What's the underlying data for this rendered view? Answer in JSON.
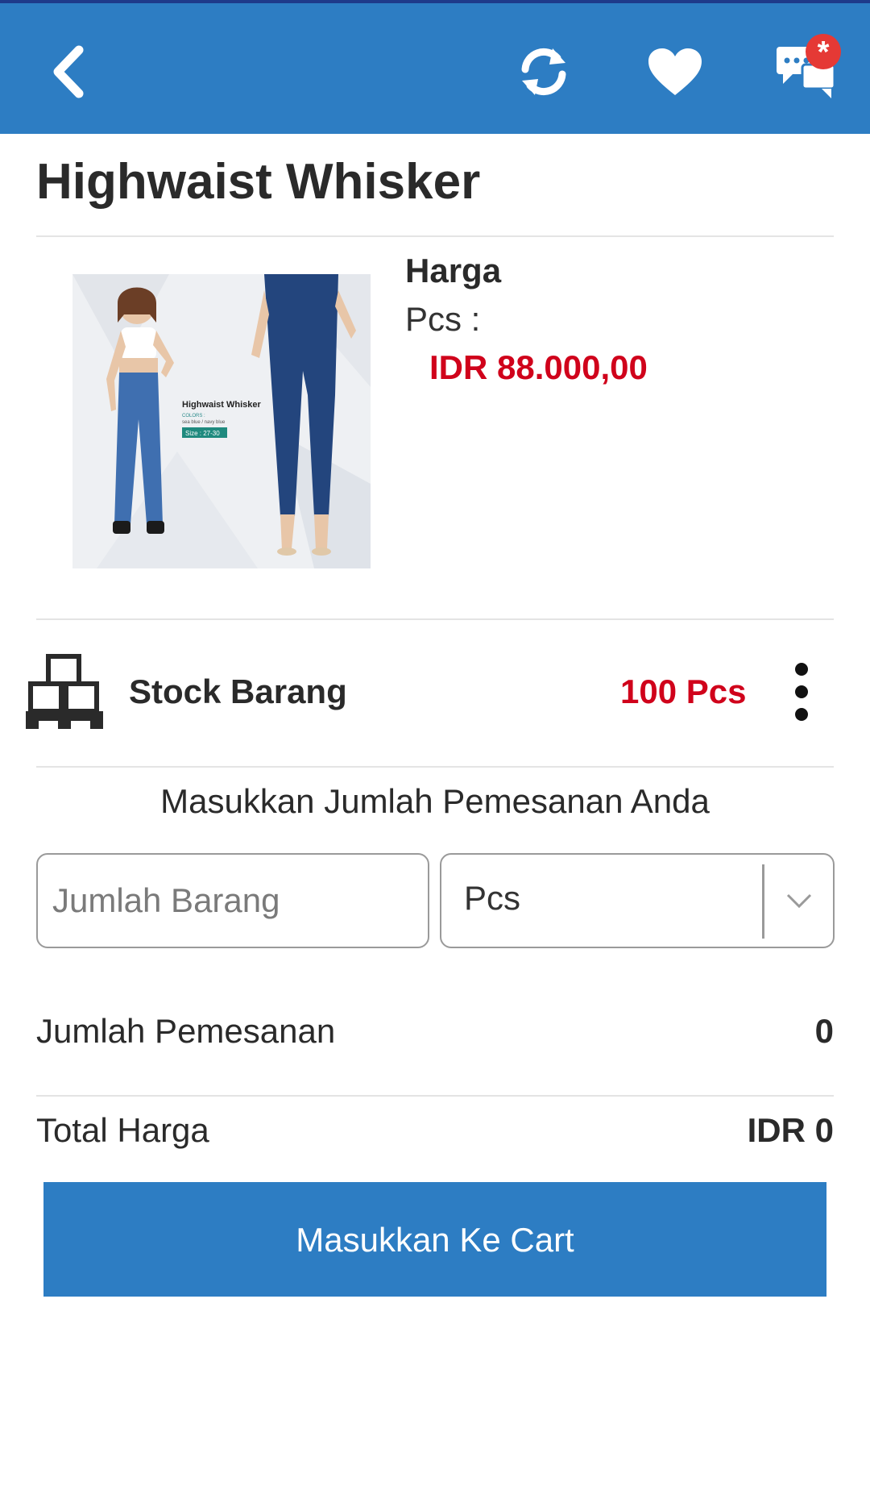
{
  "colors": {
    "primary": "#2d7dc3",
    "price_red": "#d0021b"
  },
  "appbar": {
    "back_icon": "chevron-left-icon",
    "refresh_icon": "refresh-icon",
    "favorite_icon": "heart-icon",
    "chat_icon": "chat-icon",
    "chat_badge": "*"
  },
  "product": {
    "title": "Highwaist Whisker",
    "image_caption_title": "Highwaist Whisker",
    "image_caption_colors": "COLORS :",
    "image_caption_color_list": "sea blue / navy blue",
    "image_caption_size": "Size : 27-30",
    "harga_label": "Harga",
    "unit_label": "Pcs  :",
    "price": "IDR 88.000,00"
  },
  "stock": {
    "label": "Stock Barang",
    "value": "100 Pcs"
  },
  "order": {
    "prompt": "Masukkan Jumlah Pemesanan Anda",
    "qty_placeholder": "Jumlah Barang",
    "unit_selected": "Pcs",
    "quantity_label": "Jumlah Pemesanan",
    "quantity_value": "0",
    "total_label": "Total Harga",
    "total_value": "IDR 0",
    "cart_button": "Masukkan Ke Cart"
  }
}
